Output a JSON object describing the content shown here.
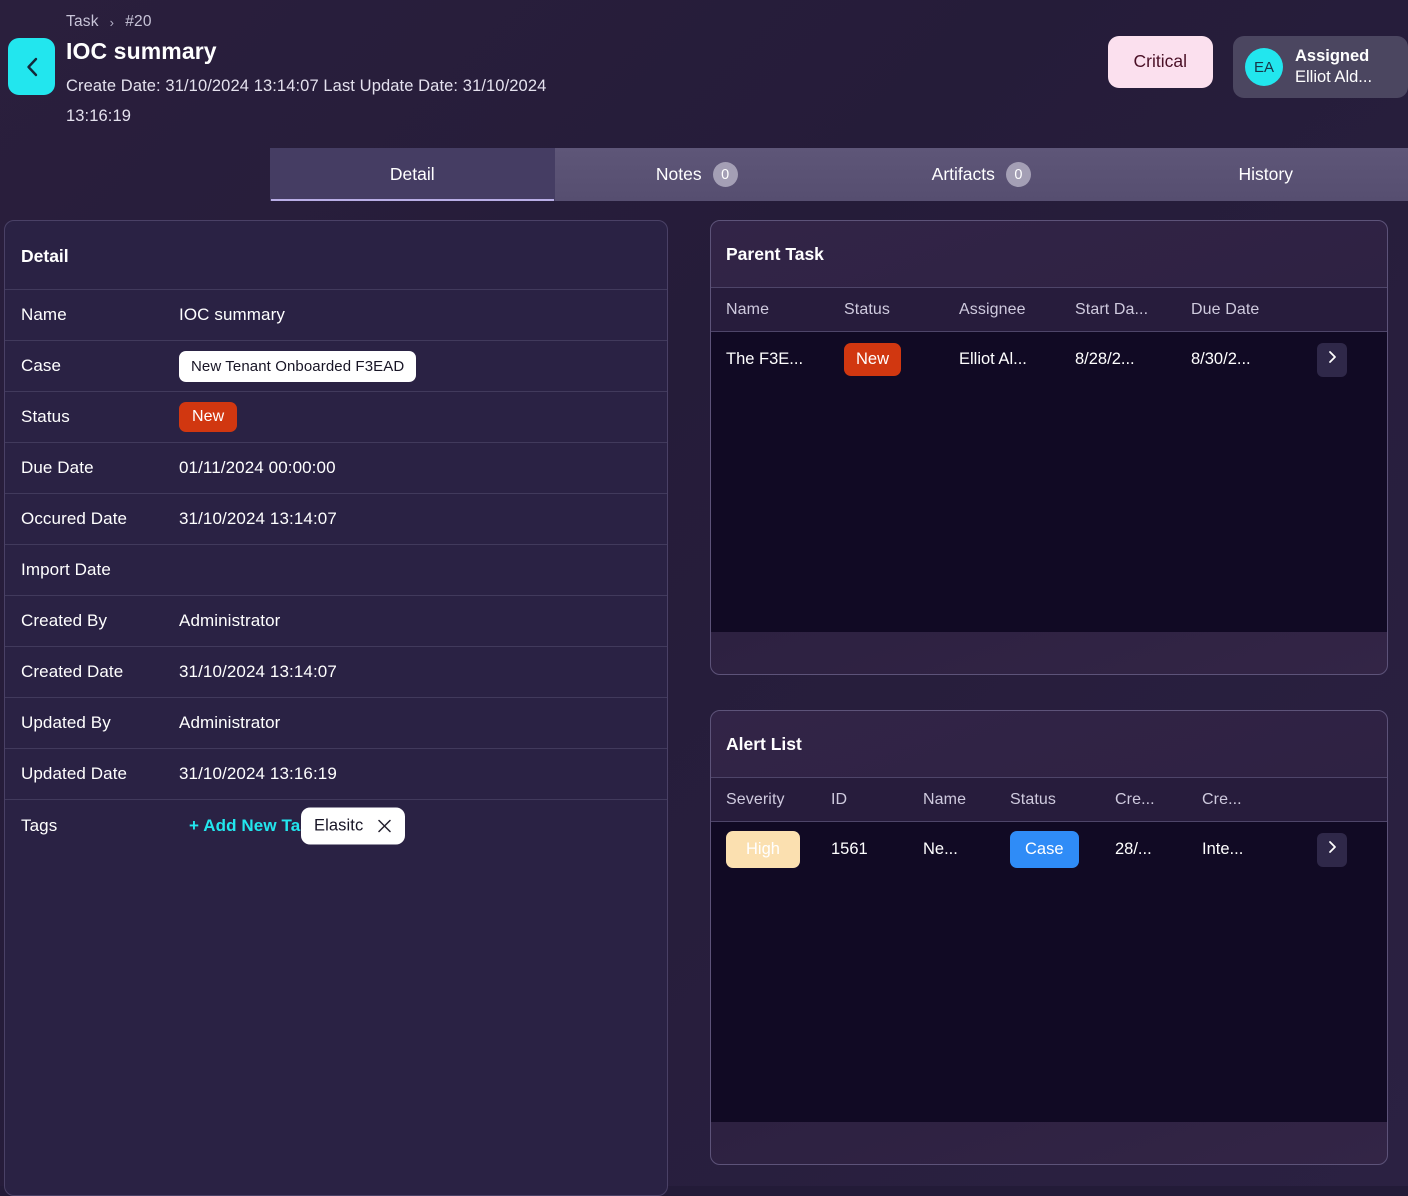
{
  "header": {
    "back_icon": "chevron-left-icon",
    "breadcrumb": {
      "root": "Task",
      "separator": "›",
      "current": "#20"
    },
    "title": "IOC summary",
    "subtitle": "Create Date: 31/10/2024 13:14:07  Last Update Date: 31/10/2024 13:16:19",
    "severity_badge": "Critical",
    "assignee": {
      "initials": "EA",
      "line1": "Assigned",
      "line2": "Elliot Ald..."
    }
  },
  "tabs": [
    {
      "label": "Detail",
      "count": null,
      "active": true
    },
    {
      "label": "Notes",
      "count": "0",
      "active": false
    },
    {
      "label": "Artifacts",
      "count": "0",
      "active": false
    },
    {
      "label": "History",
      "count": null,
      "active": false
    }
  ],
  "detail": {
    "title": "Detail",
    "rows": [
      {
        "label": "Name",
        "value": "IOC summary",
        "kind": "text"
      },
      {
        "label": "Case",
        "value": "New Tenant Onboarded F3EAD",
        "kind": "chip-white"
      },
      {
        "label": "Status",
        "value": "New",
        "kind": "chip-new"
      },
      {
        "label": "Due Date",
        "value": "01/11/2024 00:00:00",
        "kind": "text"
      },
      {
        "label": "Occured Date",
        "value": "31/10/2024 13:14:07",
        "kind": "text"
      },
      {
        "label": "Import Date",
        "value": "",
        "kind": "text"
      },
      {
        "label": "Created By",
        "value": "Administrator",
        "kind": "text"
      },
      {
        "label": "Created Date",
        "value": "31/10/2024 13:14:07",
        "kind": "text"
      },
      {
        "label": "Updated By",
        "value": "Administrator",
        "kind": "text"
      },
      {
        "label": "Updated Date",
        "value": "31/10/2024 13:16:19",
        "kind": "text"
      }
    ],
    "tags": {
      "label": "Tags",
      "add_label": "+ Add New Tag",
      "chips": [
        {
          "name": "Elasitc",
          "remove_icon": "close-icon"
        }
      ]
    }
  },
  "parent_task": {
    "title": "Parent Task",
    "columns": [
      "Name",
      "Status",
      "Assignee",
      "Start Da...",
      "Due Date"
    ],
    "rows": [
      {
        "name": "The F3E...",
        "status": "New",
        "assignee": "Elliot Al...",
        "start_date": "8/28/2...",
        "due_date": "8/30/2...",
        "chevron_icon": "chevron-right-icon"
      }
    ]
  },
  "alert_list": {
    "title": "Alert List",
    "columns": [
      "Severity",
      "ID",
      "Name",
      "Status",
      "Cre...",
      "Cre..."
    ],
    "rows": [
      {
        "severity": "High",
        "id": "1561",
        "name": "Ne...",
        "status": "Case",
        "created1": "28/...",
        "created2": "Inte...",
        "chevron_icon": "chevron-right-icon"
      }
    ]
  },
  "colors": {
    "accent_cyan": "#22e6ee",
    "status_new": "#d13710",
    "status_case": "#2f8cf7",
    "severity_high": "#fbe0b0",
    "severity_critical_bg": "#fbe0ee",
    "page_bg": "#2a1f3d"
  }
}
